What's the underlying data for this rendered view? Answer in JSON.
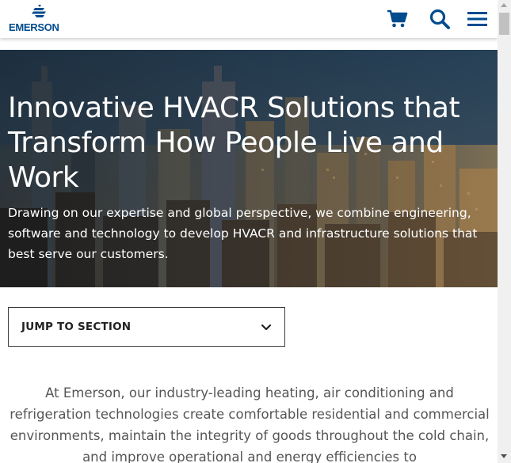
{
  "header": {
    "logo_text": "EMERSON",
    "icons": {
      "cart": "cart-icon",
      "search": "search-icon",
      "menu": "hamburger-menu-icon"
    },
    "brand_color": "#004b8d"
  },
  "hero": {
    "title": "Innovative HVACR Solutions that Transform How People Live and Work",
    "text": "Drawing on our expertise and global perspective, we combine engineering, software and technology to develop HVACR and infrastructure solutions that best serve our customers."
  },
  "jump_to_section": {
    "label": "JUMP TO SECTION",
    "icon": "chevron-down-icon"
  },
  "intro": {
    "text": "At Emerson, our industry-leading heating, air conditioning and refrigeration technologies create comfortable residential and commercial environments, maintain the integrity of goods throughout the cold chain, and improve operational and energy efficiencies to"
  }
}
